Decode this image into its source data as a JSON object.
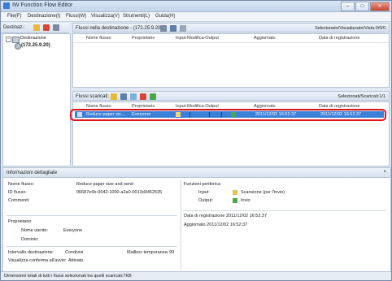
{
  "window": {
    "title": "IW Function Flow Editor",
    "min": "–",
    "max": "□",
    "close": "✕"
  },
  "menu": [
    "File(F)",
    "Destinazione(I)",
    "Flussi(W)",
    "Visualizza(V)",
    "Strumenti(L)",
    "Guida(H)"
  ],
  "left": {
    "toolbar_label": "Destinaz.:",
    "tree": {
      "expander": "−",
      "root": "Destinazione",
      "child": "(172.25.9.20)"
    }
  },
  "flows_in_dest": {
    "title": "Flussi nella destinazione - (172.25.9.20):",
    "status": "Selezionato/Visualizzato/Vista:0/0/0",
    "columns": [
      "Nome flusso",
      "Proprietario",
      "Input-Modifica-Output",
      "Aggiornato",
      "Data di registrazione"
    ]
  },
  "flows_downloaded": {
    "title": "Flussi scaricati:",
    "status": "Selezionati/Scaricati:1/1",
    "columns": [
      "Nome flusso",
      "Proprietario",
      "Input-Modifica-Output",
      "Aggiornato",
      "Data di registrazione"
    ],
    "row": {
      "name": "Reduce paper siz...",
      "owner": "Everyone",
      "updated": "2011/12/02 16:52:37",
      "registered": "2011/12/02 16:52:37"
    }
  },
  "details": {
    "title": "Informazioni dettagliate",
    "close": "×",
    "flow_name_label": "Nome flusso:",
    "flow_name": "Reduce paper size and send",
    "flow_id_label": "ID flusso:",
    "flow_id": "06687e6b-0042-1000-a2a0-0013d3452535",
    "comments_label": "Commenti:",
    "owner_section": "Proprietario",
    "username_label": "Nome utente:",
    "username": "Everyone",
    "domain_label": "Dominio:",
    "interval_label": "Intervallo destinazione:",
    "interval": "Condivisi",
    "mailbox_label": "Mailbox temporanea:",
    "mailbox": "99",
    "confirm_label": "Visualizza conferma all'avvio:",
    "confirm": "Attivato",
    "functions_title": "Funzioni periferica",
    "input_label": "Input:",
    "input": "Scansione (per l'invio)",
    "output_label": "Output:",
    "output": "Invio",
    "reg_date": "Data di registrazione 2011/12/02 16:52:37",
    "upd_date": "Aggiornato 2011/12/02 16:52:37"
  },
  "status_bar": "Dimensioni totali di tutti i flussi selezionati tra quelli scaricati:7KB",
  "colors": {
    "selection": "#3b80d8",
    "highlight_box": "#e0141d"
  }
}
